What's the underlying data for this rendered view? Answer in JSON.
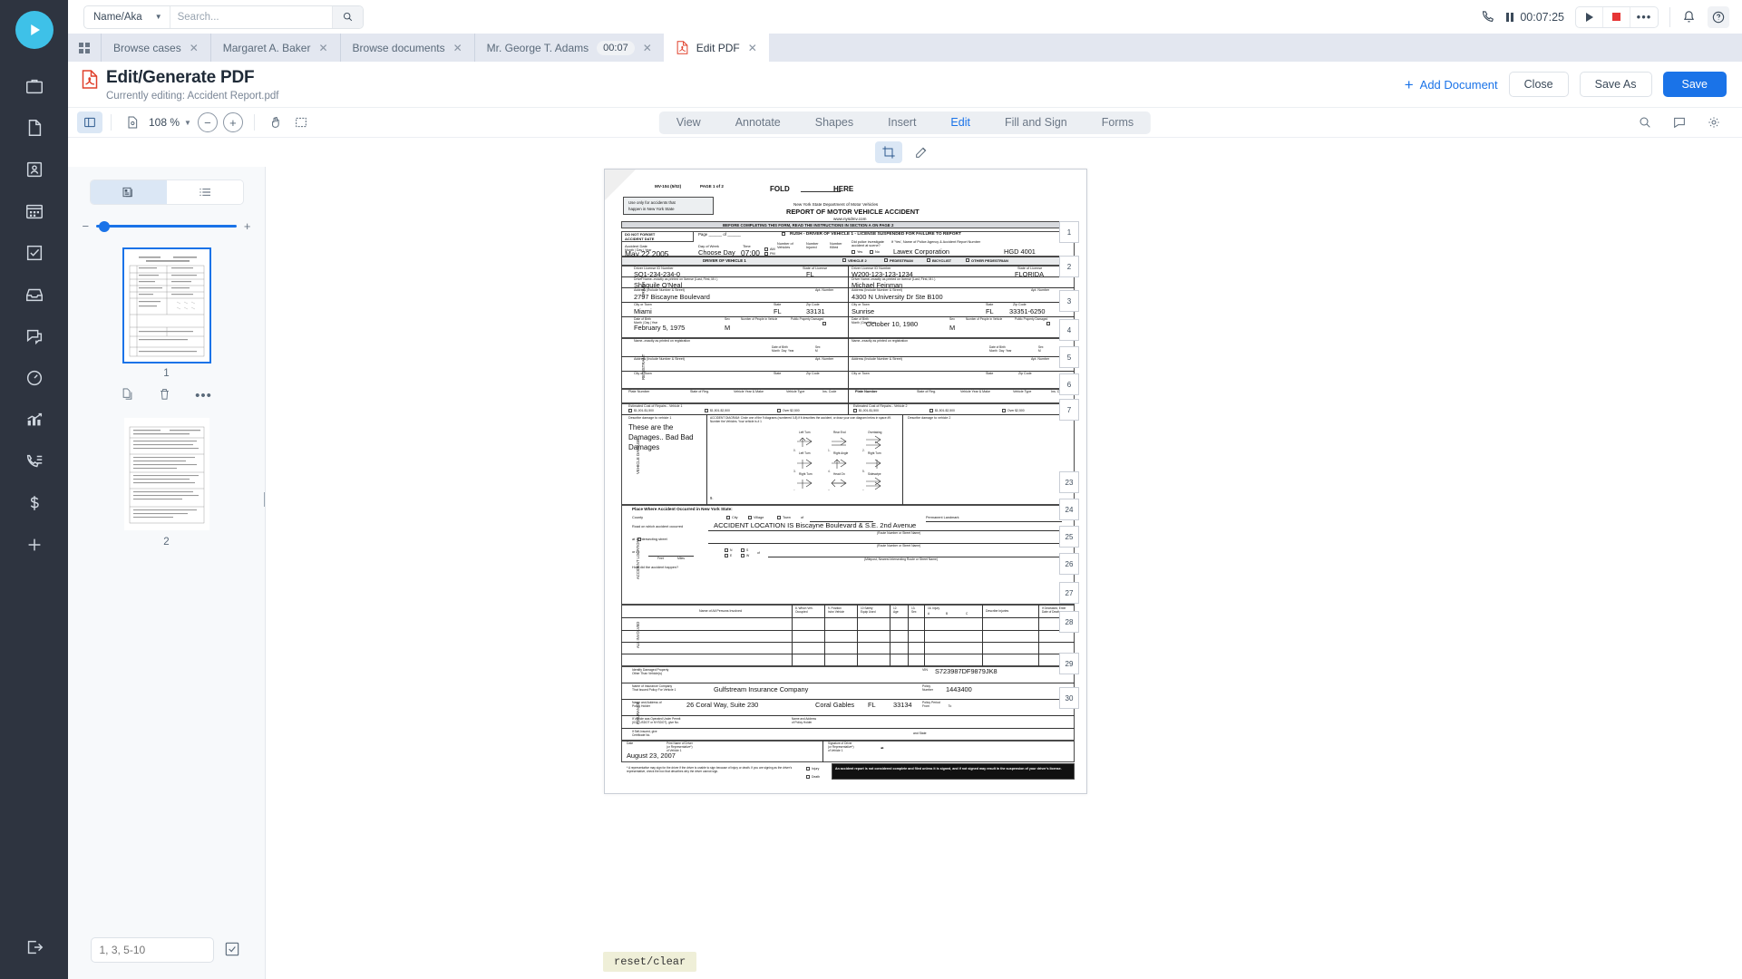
{
  "app": {
    "search": {
      "scope": "Name/Aka",
      "placeholder": "Search...",
      "value": ""
    },
    "timer": {
      "value": "00:07:25"
    }
  },
  "tabs": [
    {
      "label": "Browse cases",
      "badge": "",
      "active": false
    },
    {
      "label": "Margaret A. Baker",
      "badge": "",
      "active": false
    },
    {
      "label": "Browse documents",
      "badge": "",
      "active": false
    },
    {
      "label": "Mr. George T. Adams",
      "badge": "00:07",
      "active": false
    },
    {
      "label": "Edit PDF",
      "badge": "",
      "active": true
    }
  ],
  "header": {
    "title": "Edit/Generate PDF",
    "subtitle": "Currently editing: Accident Report.pdf",
    "add_document": "Add Document",
    "close": "Close",
    "save_as": "Save As",
    "save": "Save"
  },
  "toolbar": {
    "zoom": "108 %",
    "tabs": [
      {
        "label": "View",
        "active": false
      },
      {
        "label": "Annotate",
        "active": false
      },
      {
        "label": "Shapes",
        "active": false
      },
      {
        "label": "Insert",
        "active": false
      },
      {
        "label": "Edit",
        "active": true
      },
      {
        "label": "Fill and Sign",
        "active": false
      },
      {
        "label": "Forms",
        "active": false
      }
    ]
  },
  "thumbnails": {
    "pages": [
      {
        "number": "1",
        "selected": true
      },
      {
        "number": "2",
        "selected": false
      }
    ],
    "page_range": {
      "value": "1, 3, 5-10",
      "placeholder": "1, 3, 5-10"
    }
  },
  "document": {
    "form_id": "MV-104 (5/02)",
    "page_of": "PAGE 1 of 2",
    "fold_left": "FOLD",
    "fold_right": "HERE",
    "use_only_note": "Use only for accidents that\nhappen in New York State",
    "dept": "New York State Department of Motor Vehicles",
    "report_title": "REPORT OF MOTOR VEHICLE ACCIDENT",
    "website": "www.nysdmv.com",
    "before_completing": "BEFORE COMPLETING THIS FORM, READ THE INSTRUCTIONS IN SECTION A ON PAGE 2",
    "do_not_forget": "DO NOT FORGET\nACCIDENT DATE",
    "page_label": "Page ______ of ______",
    "rush_label": "RUSH - DRIVER OF VEHICLE 1 - LICENSE SUSPENDED FOR FAILURE TO REPORT",
    "accident_date_hdr": "Accident Date\nMonth  |  Day  |  Year",
    "accident_date": "May 22 2005",
    "day_of_week_hdr": "Day of Week",
    "day_of_week": "Choose  Day",
    "time_hdr": "Time",
    "time": "07:00",
    "am": "AM",
    "pm": "PM",
    "num_vehicles_hdr": "Number of\nVehicles",
    "num_injured_hdr": "Number\nInjured",
    "num_killed_hdr": "Number\nKilled",
    "police_investigate": "Did police investigate\naccident at scene?",
    "police_yes": "Yes",
    "police_no": "No",
    "police_agency_hdr": "If 'Yes', Name of Police Agency & Accident Report Number",
    "police_agency": "Lawex Corporation",
    "police_report_no": "HGD 4001",
    "driver_section": "DRIVER OF VEHICLE 1",
    "veh2_cb": "VEHICLE 2",
    "ped_cb": "PEDESTRIAN",
    "bic_cb": "BICYCLIST",
    "other_cb": "OTHER PEDESTRIAN",
    "side_driver": "DRIVER",
    "side_registrant": "REGISTRANT",
    "side_vehicle_damage": "VEHICLE DAMAGE",
    "side_accident_location": "ACCIDENT LOCATION",
    "side_all_involved": "ALL INVOLVED",
    "side_insurance": "INSURANCE",
    "lic_id_hdr": "Driver License ID Number",
    "v1_license": "SQ1-234-234-0",
    "v2_license": "W200-123-123-1234",
    "state_lic_hdr": "State of License",
    "v1_state": "FL",
    "v2_state": "FLORIDA",
    "name_hdr": "Driver Name--exactly as printed on license (Last, First, M.I.)",
    "v1_name": "Shaquile O'Neal",
    "v2_name": "Michael Feinman",
    "addr_hdr": "Address (Include Number & Street)",
    "v1_addr": "2797 Biscayne Boulevard",
    "v2_addr": "4300 N University Dr Ste B100",
    "apt_hdr": "Apt. Number",
    "city_hdr": "City or Town",
    "v1_city": "Miami",
    "v2_city": "Sunrise",
    "st_hdr": "State",
    "zip_hdr": "Zip Code",
    "v1_st": "FL",
    "v1_zip": "33131",
    "v2_st": "FL",
    "v2_zip": "33351-6250",
    "dob_hdr": "Date of Birth\nMonth  |  Day  |  Year",
    "v1_dob": "February 5, 1975",
    "v2_dob": "October 10, 1980",
    "sex_hdr": "Sex",
    "v1_sex": "M",
    "v2_sex": "M",
    "num_people_hdr": "Number of\nPeople in\nVehicle",
    "pub_prop_hdr": "Public\nProperty\nDamaged",
    "reg_name_hdr": "Name--exactly as printed on registration",
    "reg_addr_hdr": "Address (Include Number & Street)",
    "reg_city_hdr": "City or Town",
    "plate_hdr": "Plate Number",
    "state_reg_hdr": "State of Reg.",
    "veh_year_make_hdr": "Vehicle Year & Make",
    "veh_type_hdr": "Vehicle Type",
    "ins_code_hdr": "Ins. Code",
    "est_cost_v1": "Estimated Cost of Repairs - Vehicle 1",
    "est_cost_v2": "Estimated Cost of Repairs - Vehicle 2",
    "cost_opt1": "$1,001-$1,500",
    "cost_opt2": "$1,501-$2,500",
    "cost_opt3": "Over $2,500",
    "describe_v1": "Describe damage to vehicle 1",
    "describe_v2": "Describe damage to vehicle 2",
    "damage_text": "These are the\nDamages.. Bad Bad\nDamages",
    "accident_diagram_hdr": "ACCIDENT DIAGRAM:  Circle one of the 9 diagrams (numbered 0-8) if it\ndescribes the accident, or draw your own diagram below in space #9.\nNumber the Vehicles. Your vehicle is # 1",
    "diagram_labels": [
      "Left Turn",
      "Rear End",
      "Overtaking",
      "Left Turn",
      "Right Angle",
      "Right Turn",
      "Right Turn",
      "Head On",
      "Sideswipe"
    ],
    "place_hdr": "Place Where Accident Occurred in New York State:",
    "county_hdr": "County",
    "city_cb": "City",
    "village_cb": "Village",
    "town_cb": "Town",
    "of_lbl": "of",
    "permanent_landmark": "Permanent Landmark",
    "road_hdr": "Road on which accident occurred",
    "accident_location": "ACCIDENT LOCATION IS Biscayne Boulevard & S.E. 2nd Avenue",
    "route_hdr": "(Route Number or Street Name)",
    "at_intersect": "at    1) intersecting street",
    "or_lbl": "or      2)",
    "feet": "Feet",
    "miles": "Miles",
    "n_cb": "N",
    "s_cb": "S",
    "e_cb": "E",
    "w_cb": "W",
    "milepost_hdr": "(Milepost, Nearest Intersecting Route or Street Name)",
    "how_happen": "How did the accident happen?",
    "persons_hdr": "Name of All Persons Involved",
    "which_veh_hdr": "8. Which Veh.\nOccupied",
    "position_hdr": "9. Position\nin/on Vehicle",
    "safety_hdr": "10 Safety\nEquip Used",
    "age_hdr": "12.\nAge",
    "sex2_hdr": "13.\nSex",
    "injury_hdr": "16. Injury",
    "injury_a": "A",
    "injury_b": "B",
    "injury_c": "C",
    "describe_injuries": "Describe Injuries",
    "deceased_hdr": "If Deceased, Enter\nDate of Death",
    "damaged_prop_hdr": "Identify Damaged Property\nOther Than Vehicle(s)",
    "vin_hdr": "VIN",
    "vin": "S723987DF9879JK8",
    "ins_company_hdr": "Name of Insurance Company\nThat Issued Policy For Vehicle 1",
    "ins_company": "Gulfstream Insurance Company",
    "policy_no_hdr": "Policy\nNumber",
    "policy_no": "1443400",
    "policyholder_hdr": "Name and Address of\nPolicy Holder",
    "policyholder": "26 Coral Way, Suite 230",
    "policyholder_city": "Coral Gables",
    "policyholder_state": "FL",
    "policyholder_zip": "33134",
    "policy_period_hdr": "Policy Period\nFrom                          To",
    "operated_hdr": "If Vehicle was Operated Under Permit\n(ICC, USDOT or NYSDOT), give No.",
    "name_address_ph": "Name and Address\nof Policy Holder",
    "self_insured": "If Self-Insured, give\nCertificate No.",
    "and_state": "and State",
    "date_hdr": "Date",
    "date_value": "August 23, 2007",
    "print_name_hdr": "Print Name of Driver\n(or Representative*)\nof Vehicle 1",
    "signature_hdr": "Signature of Driver\n(or Representative*)\nof Vehicle 1",
    "rep_note": "*  A representative may sign for the driver if the driver is unable to sign\nbecause of injury or death. If you are signing as the driver's representative,\ncheck the box that describes why the driver cannot sign.",
    "injury_cb": "Injury",
    "death_cb": "Death",
    "not_complete_note": "An accident report is not considered complete and filed unless it is signed,\nand if not signed may result in the suspension of your driver's license.",
    "reset_clear": "reset/clear",
    "page_marks": [
      "1",
      "2",
      "3",
      "4",
      "5",
      "6",
      "7",
      "23",
      "24",
      "25",
      "26",
      "27",
      "28",
      "29",
      "30"
    ]
  }
}
